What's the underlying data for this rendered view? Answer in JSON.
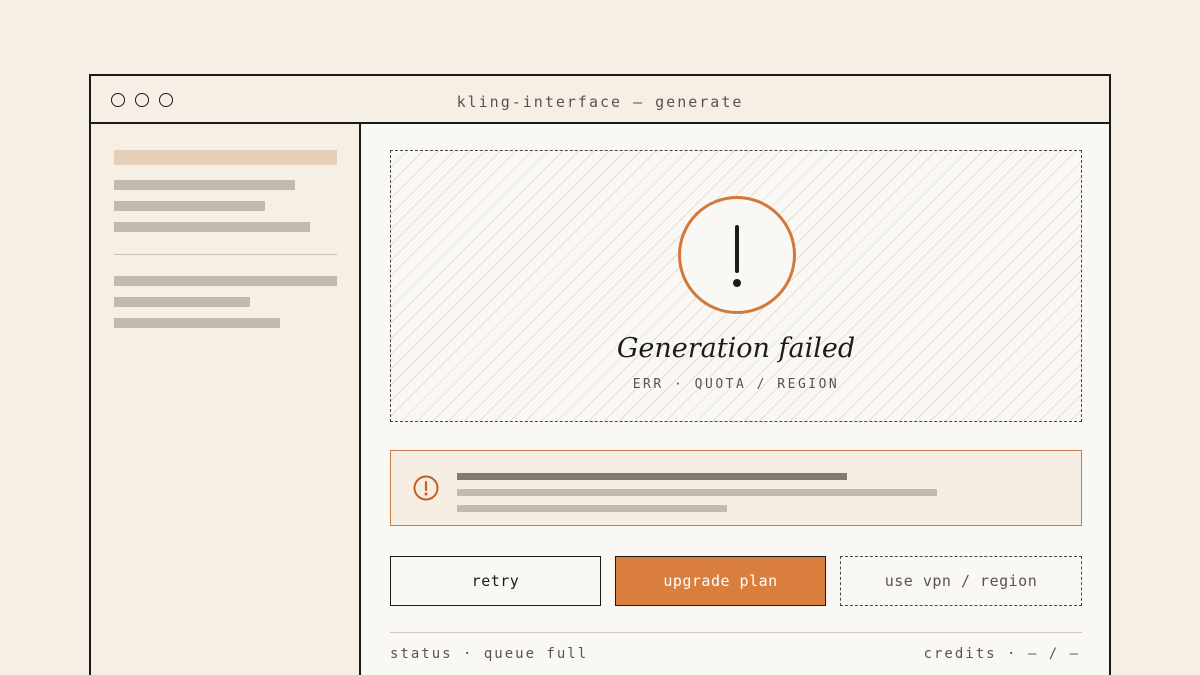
{
  "window": {
    "title": "kling-interface — generate",
    "controls": [
      "window-dot",
      "window-dot",
      "window-dot"
    ]
  },
  "preview": {
    "icon": "exclamation-icon",
    "heading": "Generation failed",
    "error_code": "ERR · QUOTA / REGION"
  },
  "alert": {
    "icon": "alert-exclamation-icon"
  },
  "actions": {
    "retry_label": "retry",
    "upgrade_label": "upgrade plan",
    "vpn_label": "use vpn / region"
  },
  "footer": {
    "status": "status · queue full",
    "credits": "credits · — / —"
  },
  "colors": {
    "accent": "#d97e3d",
    "background": "#f6efe6",
    "ink": "#1c1b19"
  }
}
